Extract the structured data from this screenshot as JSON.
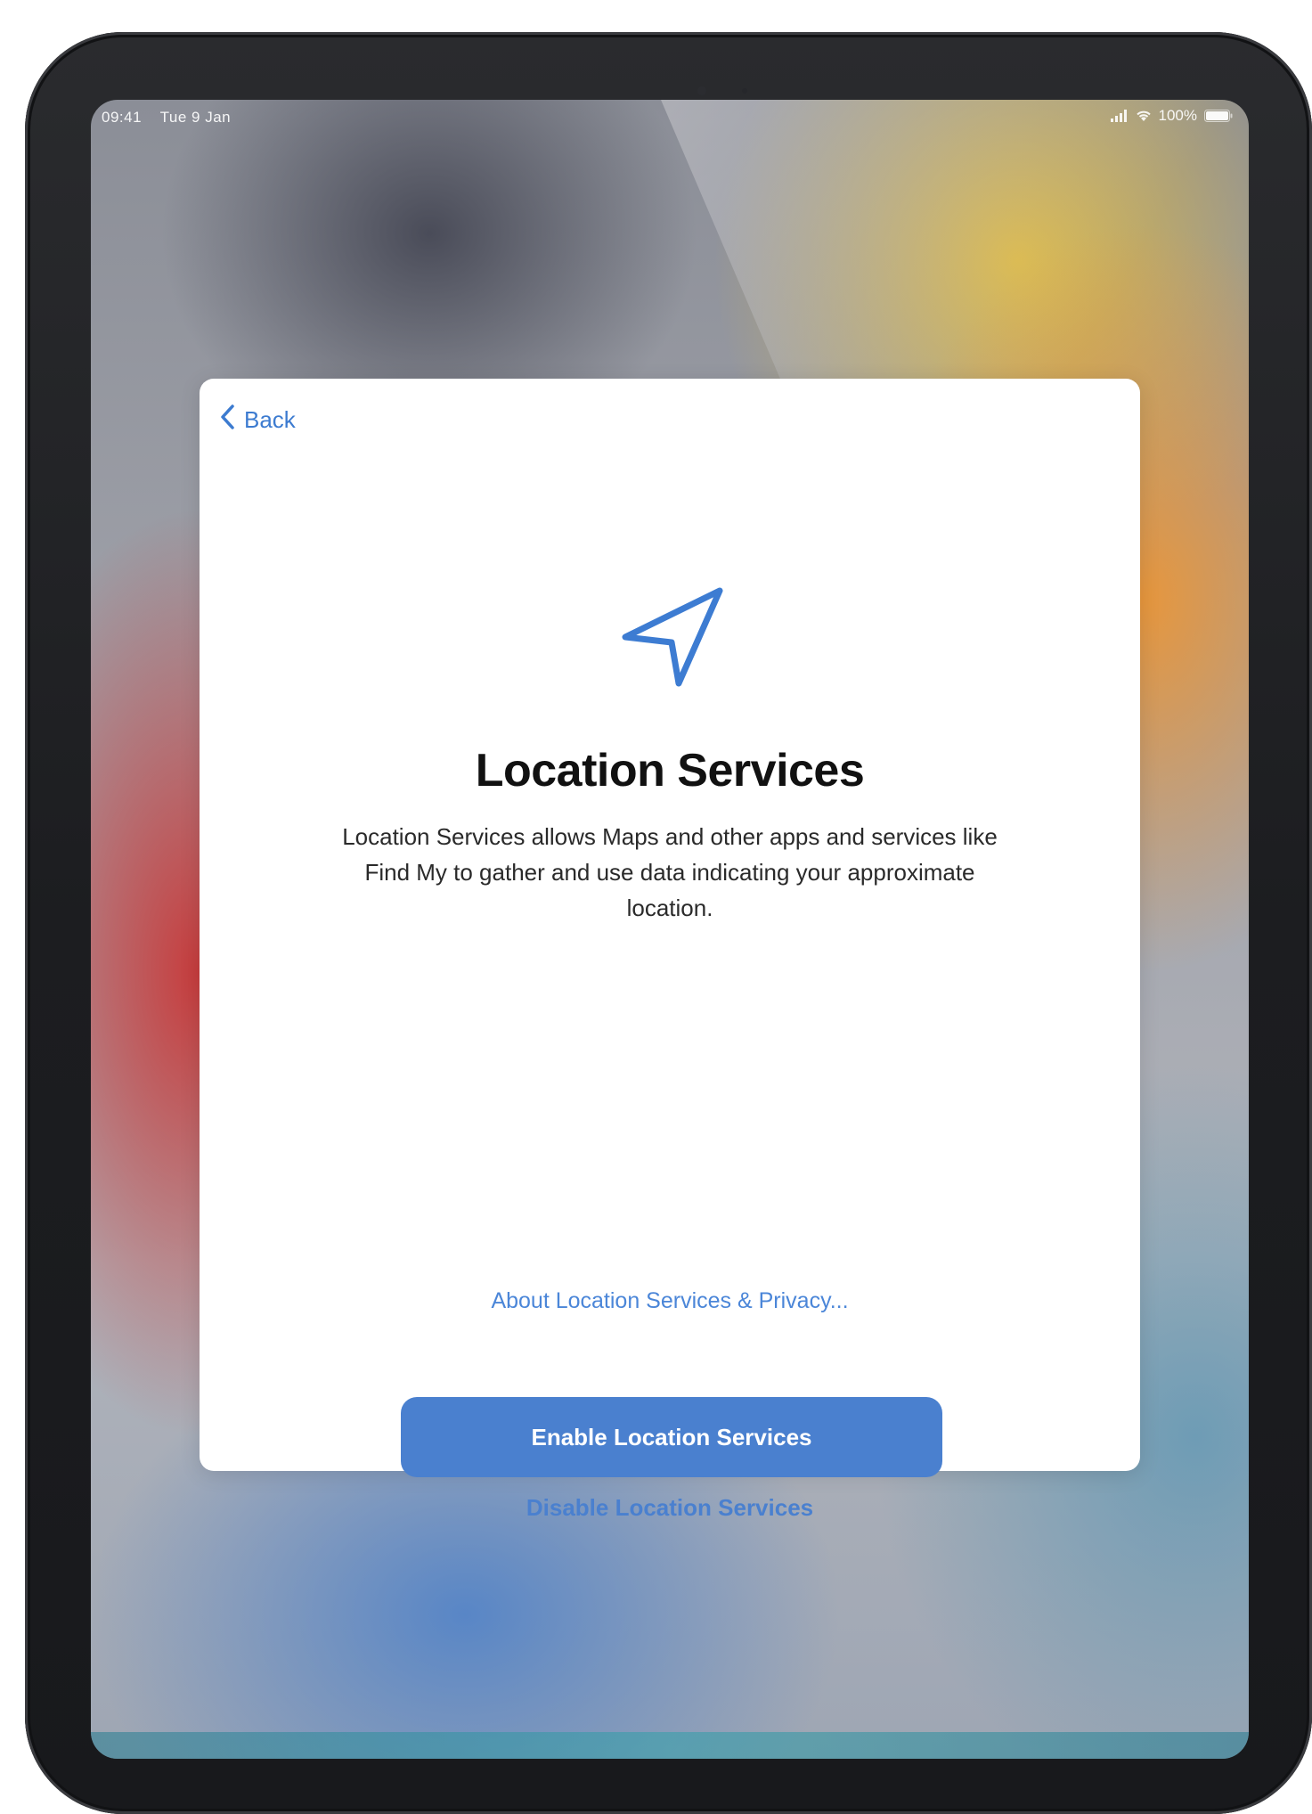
{
  "status_bar": {
    "time": "09:41",
    "date": "Tue 9 Jan",
    "battery": "100%",
    "icons": [
      "signal-icon",
      "wifi-icon",
      "battery-icon"
    ]
  },
  "navigation": {
    "back_label": "Back"
  },
  "screen": {
    "icon": "location-arrow-icon",
    "title": "Location Services",
    "description": "Location Services allows Maps and other apps and services like Find My to gather and use data indicating your approximate location.",
    "about_link": "About Location Services & Privacy...",
    "enable_button": "Enable Location Services",
    "disable_button": "Disable Location Services"
  },
  "colors": {
    "accent": "#4a80cf",
    "link": "#4b86d8",
    "card_background": "#ffffff",
    "device_bezel": "#1c1d20"
  }
}
